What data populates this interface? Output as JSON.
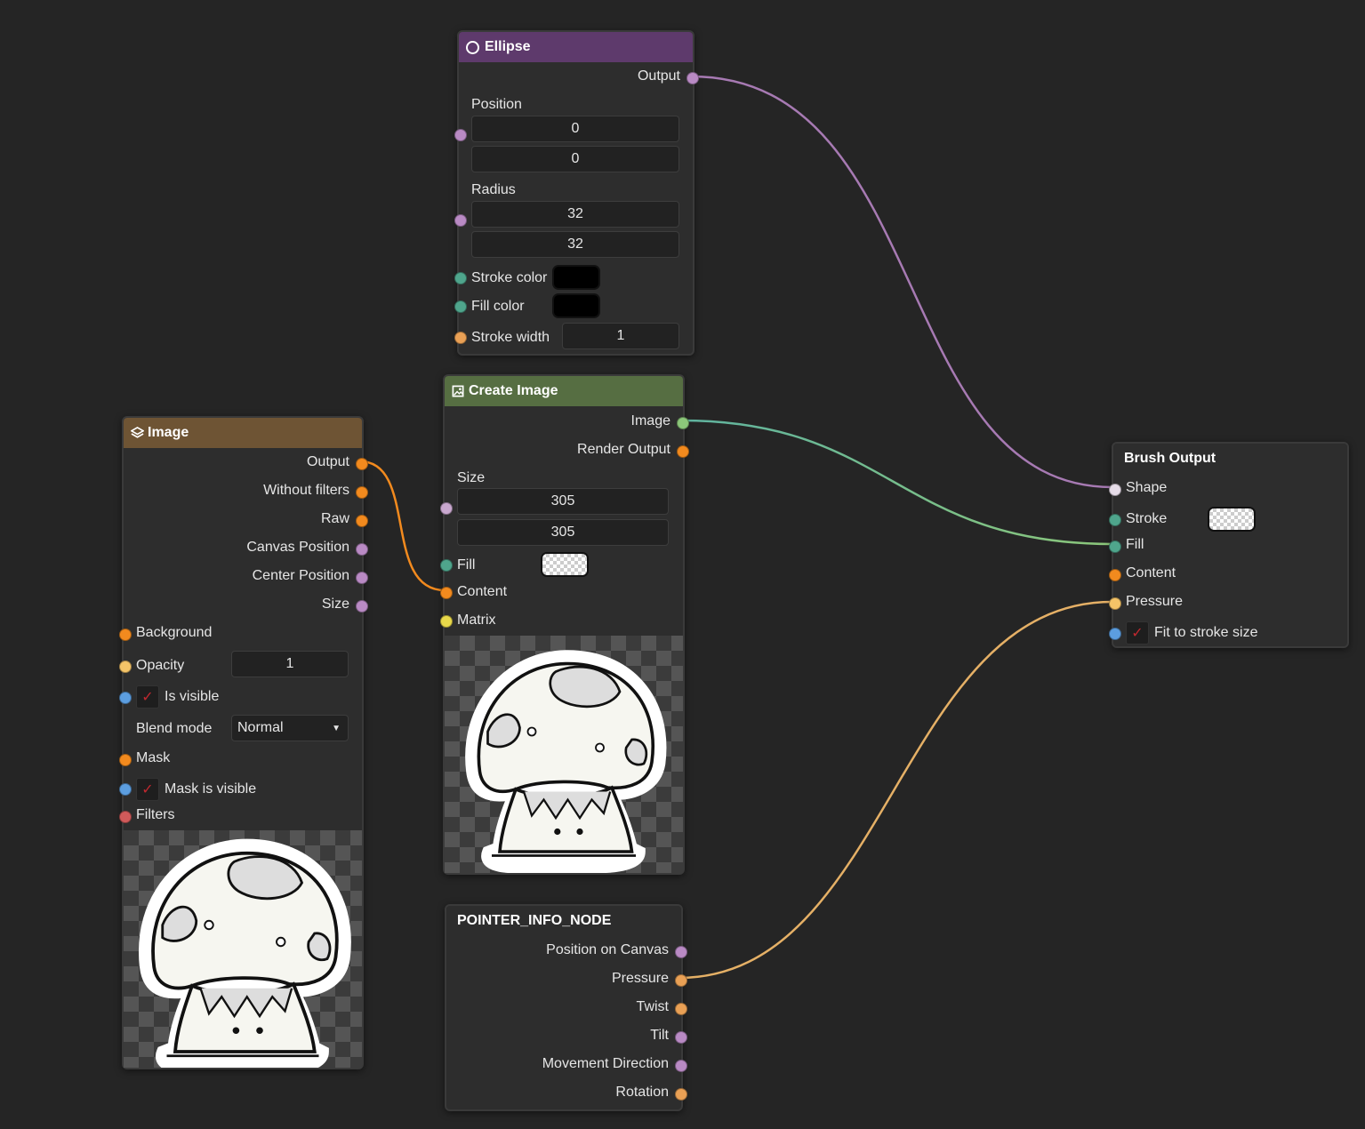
{
  "colors": {
    "background": "#252525",
    "ellipse_header": "#5e3a6c",
    "create_image_header": "#566e42",
    "image_header": "#6e5434",
    "wire_shape": "#a77ab3",
    "wire_image": "#6bb89a",
    "wire_pressure": "#e5b066",
    "wire_content": "#f28a1e"
  },
  "ellipse_node": {
    "title": "Ellipse",
    "icon": "circle-outline-icon",
    "output_label": "Output",
    "position_label": "Position",
    "position_x": "0",
    "position_y": "0",
    "radius_label": "Radius",
    "radius_x": "32",
    "radius_y": "32",
    "stroke_color_label": "Stroke color",
    "fill_color_label": "Fill color",
    "stroke_width_label": "Stroke width",
    "stroke_width": "1"
  },
  "create_image_node": {
    "title": "Create Image",
    "icon": "image-edit-icon",
    "image_output": "Image",
    "render_output": "Render Output",
    "size_label": "Size",
    "size_w": "305",
    "size_h": "305",
    "fill_label": "Fill",
    "content_label": "Content",
    "matrix_label": "Matrix"
  },
  "image_node": {
    "title": "Image",
    "icon": "layers-icon",
    "outputs": [
      "Output",
      "Without filters",
      "Raw",
      "Canvas Position",
      "Center Position",
      "Size"
    ],
    "background_label": "Background",
    "opacity_label": "Opacity",
    "opacity_value": "1",
    "is_visible_label": "Is visible",
    "blend_mode_label": "Blend mode",
    "blend_mode_value": "Normal",
    "mask_label": "Mask",
    "mask_visible_label": "Mask is visible",
    "filters_label": "Filters"
  },
  "pointer_node": {
    "title": "POINTER_INFO_NODE",
    "outputs": [
      "Position on Canvas",
      "Pressure",
      "Twist",
      "Tilt",
      "Movement Direction",
      "Rotation"
    ]
  },
  "brush_output_node": {
    "title": "Brush Output",
    "shape_label": "Shape",
    "stroke_label": "Stroke",
    "fill_label": "Fill",
    "content_label": "Content",
    "pressure_label": "Pressure",
    "fit_label": "Fit to stroke size"
  }
}
